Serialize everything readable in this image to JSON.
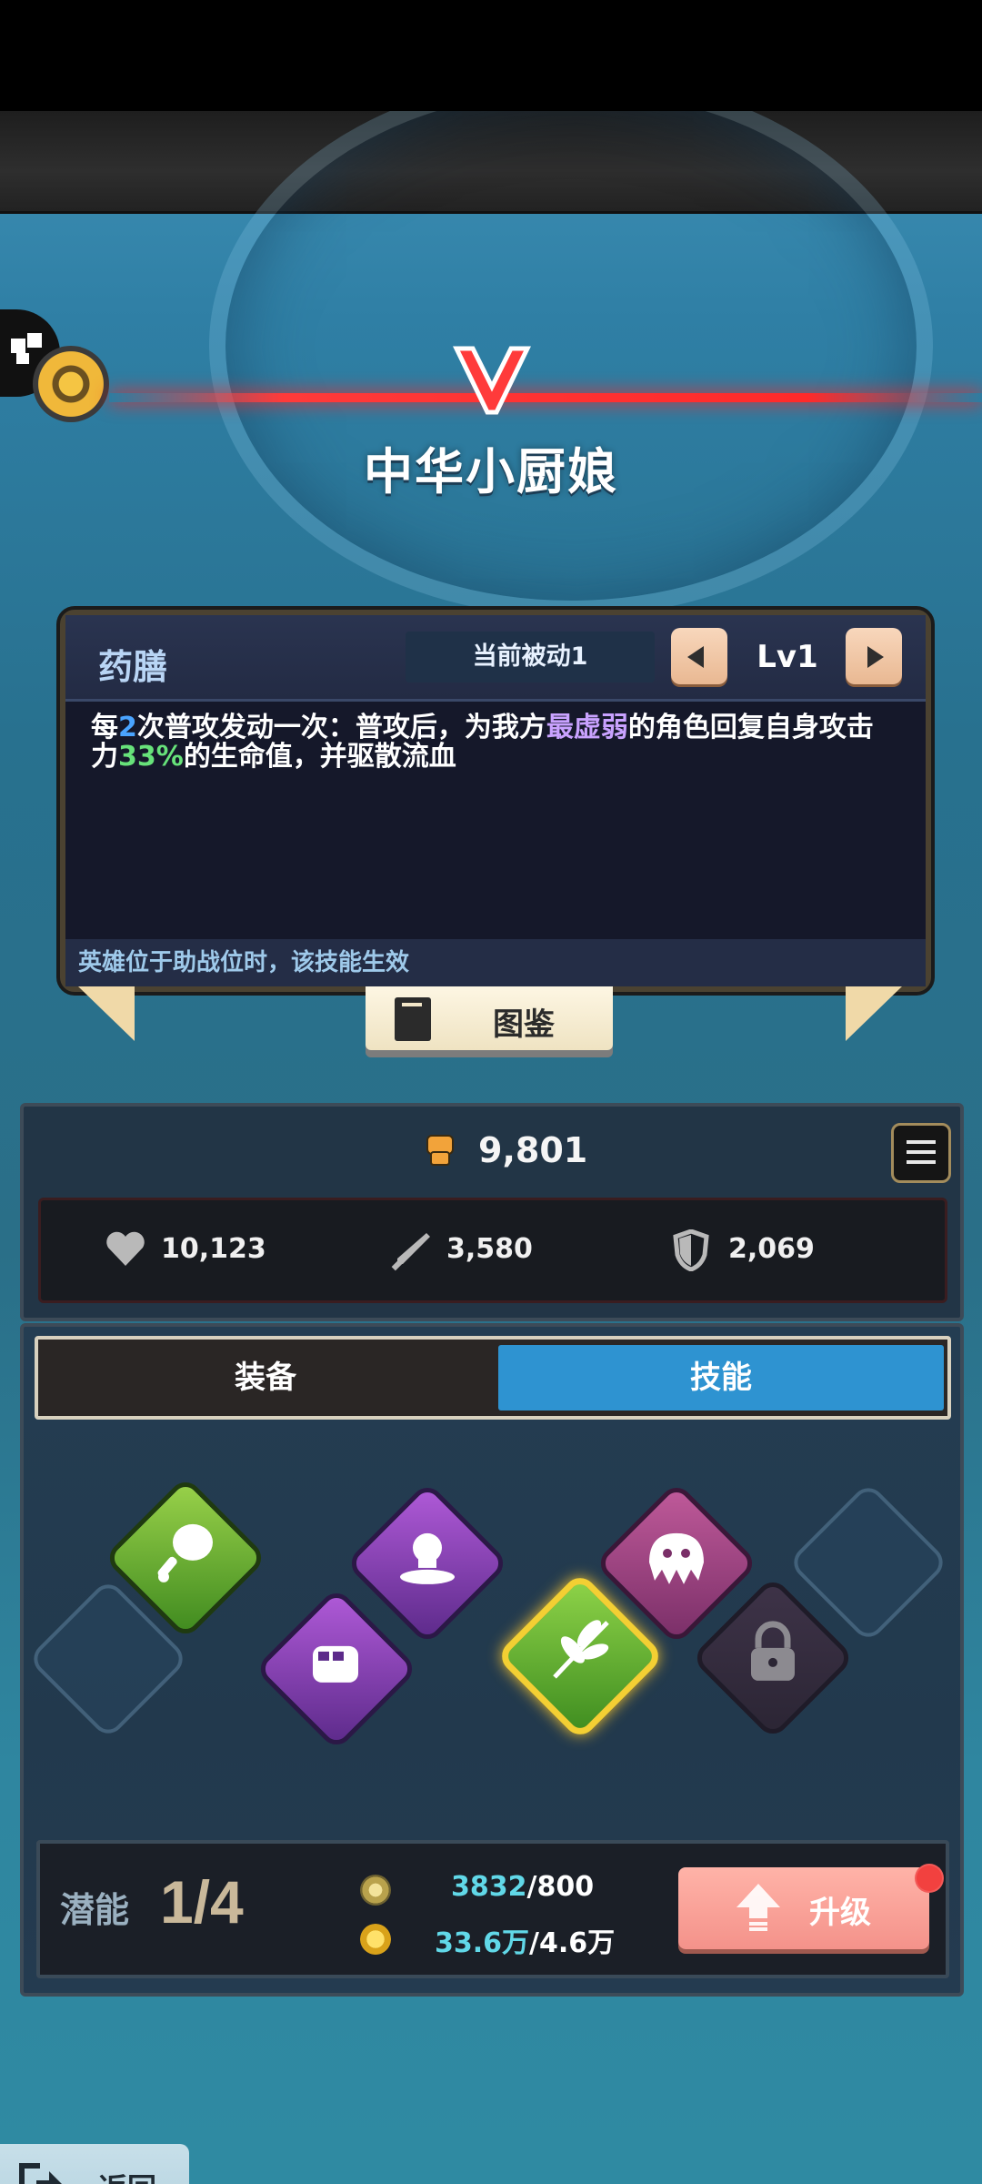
{
  "hero": {
    "name": "中华小厨娘"
  },
  "skill_card": {
    "skill_name": "药膳",
    "slot_label": "当前被动1",
    "level": "Lv1",
    "description": {
      "p1": "每",
      "n1": "2",
      "p2": "次普攻发动一次：普攻后，为我方",
      "target": "最虚弱",
      "p3": "的角色回复自身攻击力",
      "pct": "33%",
      "p4": "的生命值，并驱散流血"
    },
    "footer": "英雄位于助战位时，该技能生效"
  },
  "codex_button": {
    "label": "图鉴"
  },
  "stats": {
    "power": "9,801",
    "hp": "10,123",
    "attack": "3,580",
    "defense": "2,069"
  },
  "tabs": {
    "equip": "装备",
    "skill": "技能",
    "active": "技能"
  },
  "potential": {
    "label": "潜能",
    "value": "1/4",
    "res1_current": "3832",
    "res1_required": "/800",
    "res2_current": "33.6万",
    "res2_required": "/4.6万"
  },
  "upgrade_button": {
    "label": "升级"
  },
  "back_button": {
    "label": "返回"
  },
  "colors": {
    "accent_blue": "#2e93d1",
    "highlight_purple": "#c9a2ff",
    "highlight_green": "#67e27a",
    "upgrade_pink": "#f4928a"
  },
  "icons": [
    "eye-icon",
    "puzzle-icon",
    "chevron-left-icon",
    "chevron-right-icon",
    "book-icon",
    "fist-icon",
    "menu-list-icon",
    "heart-icon",
    "sword-icon",
    "shield-icon",
    "drumstick-icon",
    "punch-icon",
    "skull-icon",
    "leaf-icon",
    "slime-icon",
    "lock-icon",
    "gear-coin-icon",
    "gold-coin-icon",
    "arrow-up-icon",
    "exit-icon"
  ]
}
